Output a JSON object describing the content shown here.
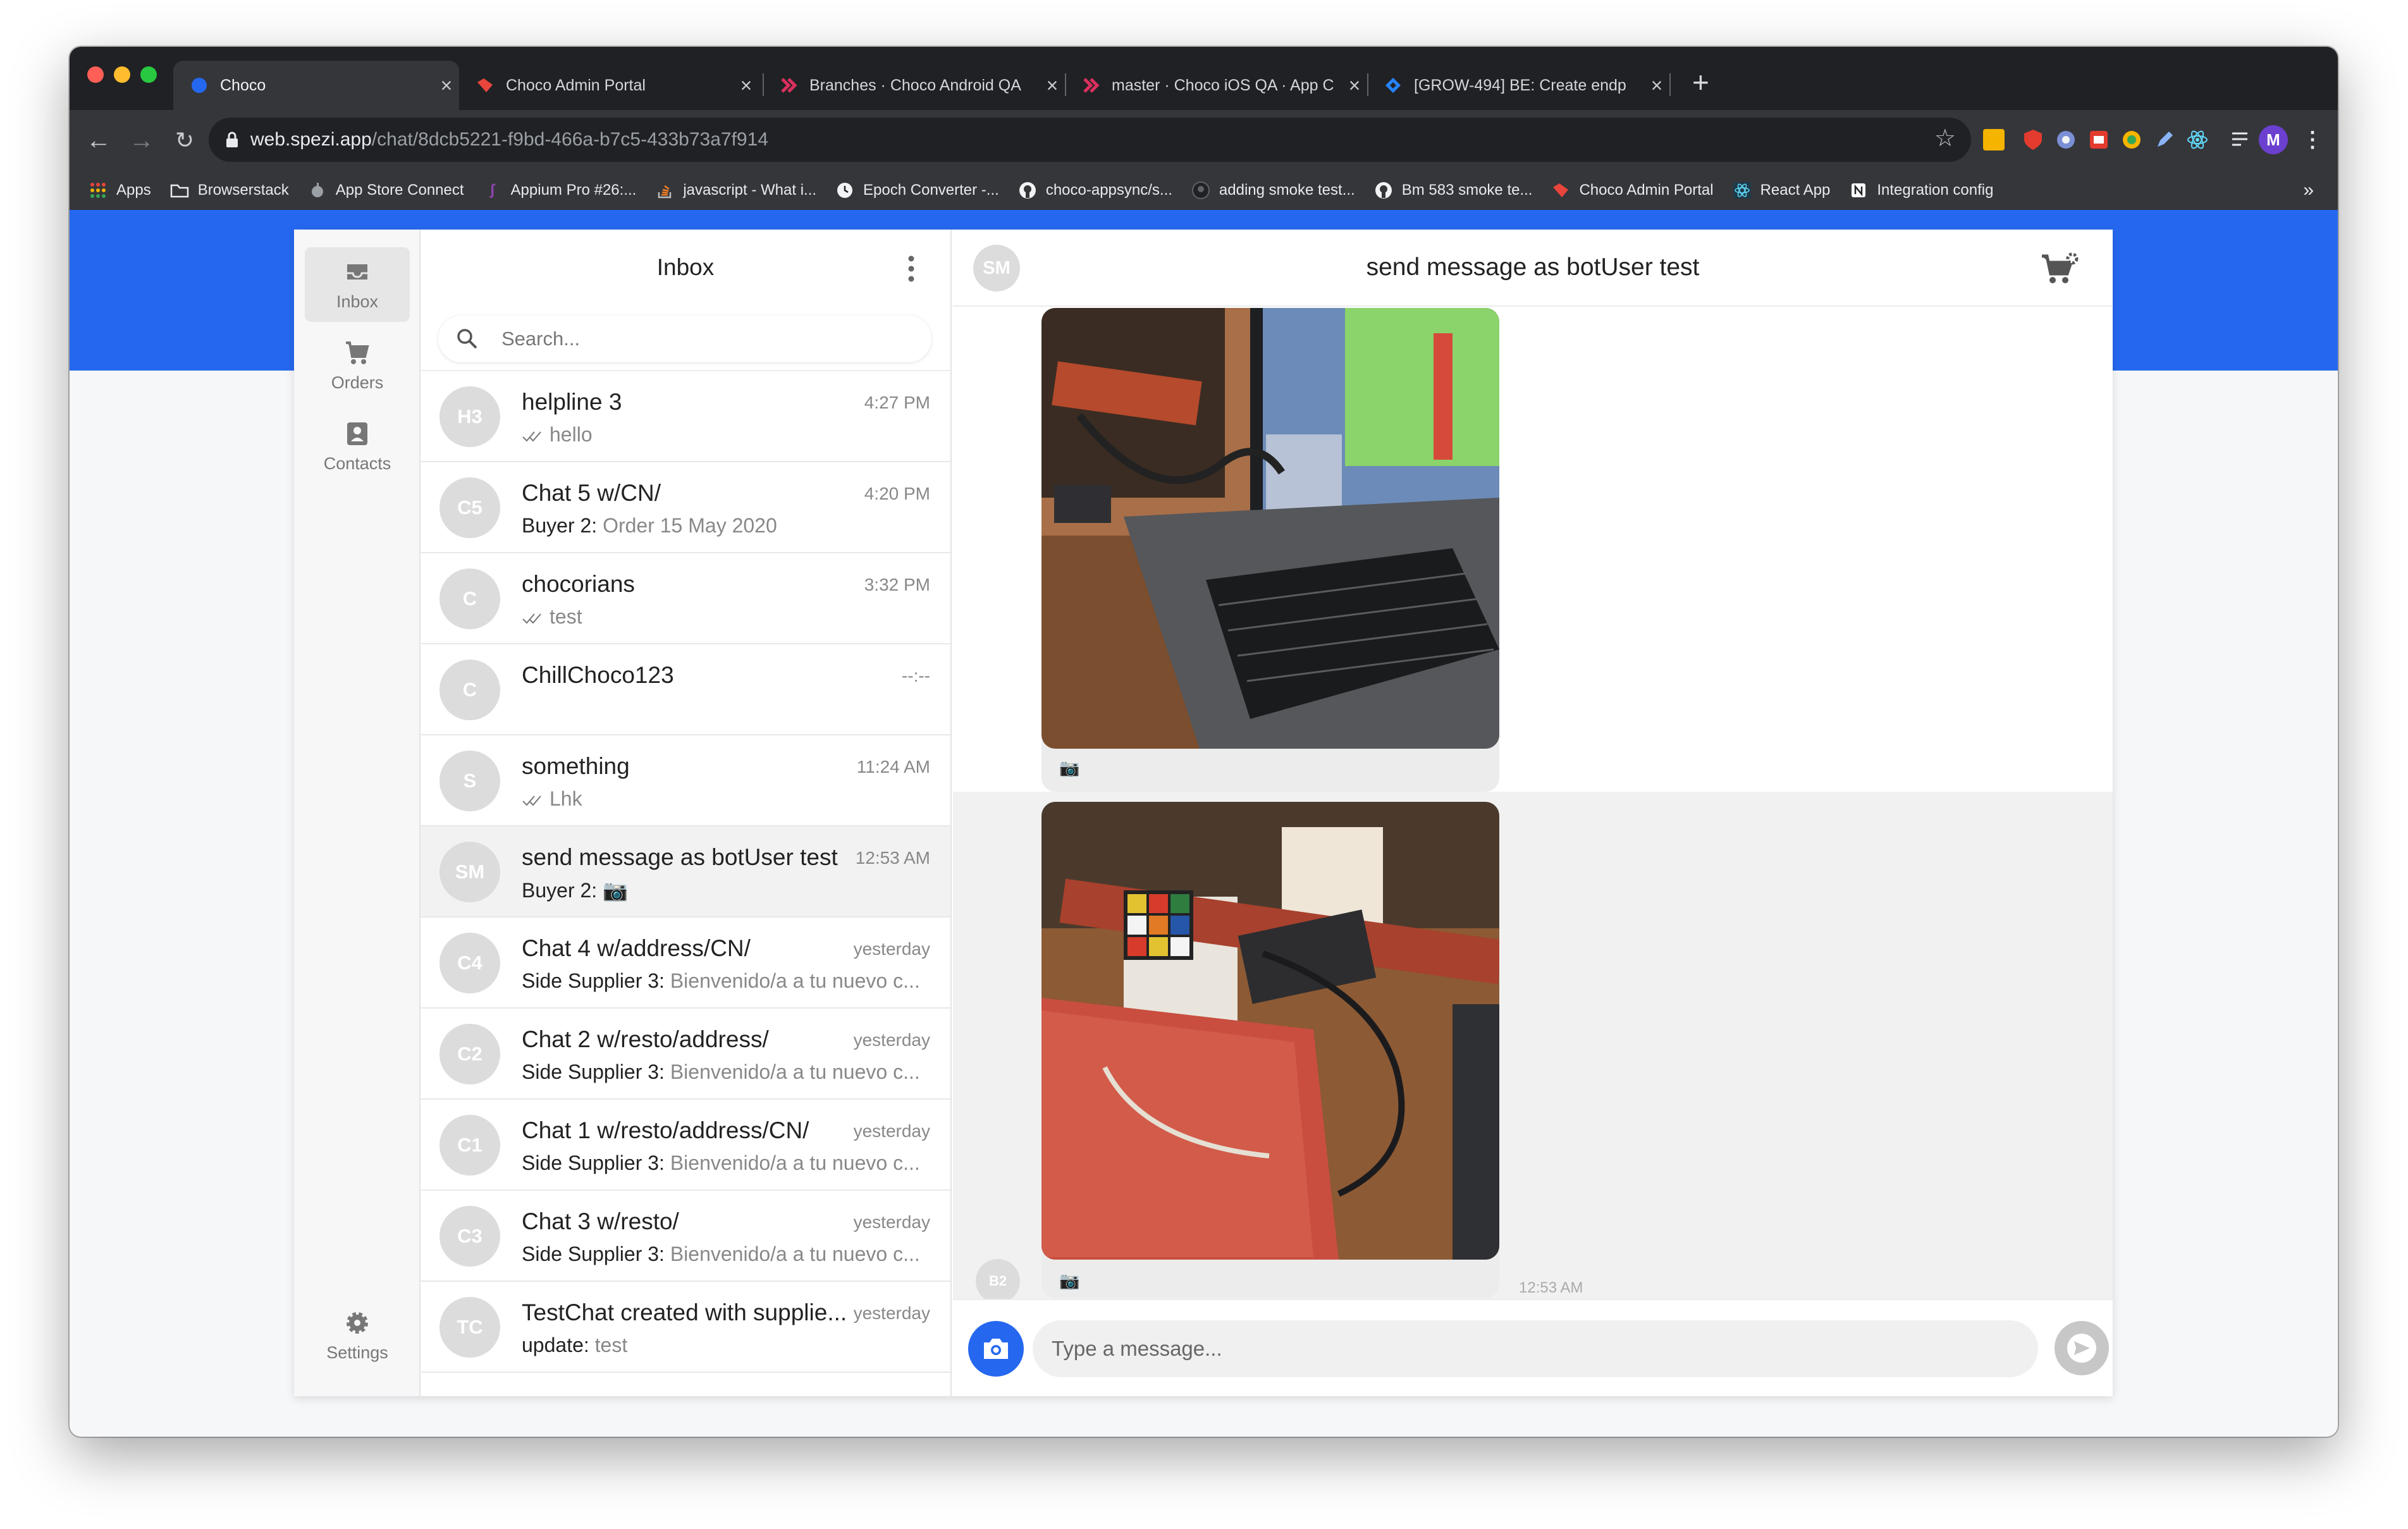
{
  "browser": {
    "tabs": [
      {
        "title": "Choco",
        "favicon": "blue-circle",
        "color": "#2568ef"
      },
      {
        "title": "Choco Admin Portal",
        "favicon": "choco-logo",
        "color": "#e8453c"
      },
      {
        "title": "Branches · Choco Android QA",
        "favicon": "bitrise-logo",
        "color": "#d9305d"
      },
      {
        "title": "master · Choco iOS QA · App C",
        "favicon": "bitrise-logo",
        "color": "#d9305d"
      },
      {
        "title": "[GROW-494] BE: Create endp",
        "favicon": "jira-logo",
        "color": "#2684ff"
      }
    ],
    "url_host": "web.spezi.app",
    "url_path": "/chat/8dcb5221-f9bd-466a-b7c5-433b73a7f914",
    "profile_initial": "M",
    "bookmarks": [
      {
        "label": "Apps",
        "icon": "apps-grid-icon"
      },
      {
        "label": "Browserstack",
        "icon": "folder-icon"
      },
      {
        "label": "App Store Connect",
        "icon": "apple-icon"
      },
      {
        "label": "Appium Pro #26:...",
        "icon": "appium-icon"
      },
      {
        "label": "javascript - What i...",
        "icon": "stackoverflow-icon"
      },
      {
        "label": "Epoch Converter -...",
        "icon": "clock-icon"
      },
      {
        "label": "choco-appsync/s...",
        "icon": "github-icon"
      },
      {
        "label": "adding smoke test...",
        "icon": "github-icon"
      },
      {
        "label": "Bm 583 smoke te...",
        "icon": "github-icon"
      },
      {
        "label": "Choco Admin Portal",
        "icon": "choco-logo"
      },
      {
        "label": "React App",
        "icon": "react-icon"
      },
      {
        "label": "Integration config",
        "icon": "notion-icon"
      }
    ],
    "bookmarks_overflow": "»"
  },
  "nav": {
    "inbox": "Inbox",
    "orders": "Orders",
    "contacts": "Contacts",
    "settings": "Settings"
  },
  "inbox": {
    "title": "Inbox",
    "search_placeholder": "Search...",
    "chats": [
      {
        "initials": "H3",
        "name": "helpline 3",
        "time": "4:27 PM",
        "sender": "",
        "preview": "hello",
        "read_ticks": true
      },
      {
        "initials": "C5",
        "name": "Chat 5 w/CN/",
        "time": "4:20 PM",
        "sender": "Buyer 2:",
        "preview": "Order 15 May 2020",
        "read_ticks": false
      },
      {
        "initials": "C",
        "name": "chocorians",
        "time": "3:32 PM",
        "sender": "",
        "preview": "test",
        "read_ticks": true
      },
      {
        "initials": "C",
        "name": "ChillChoco123",
        "time": "--:--",
        "sender": "",
        "preview": "",
        "read_ticks": false
      },
      {
        "initials": "S",
        "name": "something",
        "time": "11:24 AM",
        "sender": "",
        "preview": "Lhk",
        "read_ticks": true
      },
      {
        "initials": "SM",
        "name": "send message as botUser test",
        "time": "12:53 AM",
        "sender": "Buyer 2:",
        "preview": "📷",
        "read_ticks": false,
        "selected": true
      },
      {
        "initials": "C4",
        "name": "Chat 4 w/address/CN/",
        "time": "yesterday",
        "sender": "Side Supplier 3:",
        "preview": "Bienvenido/a a tu nuevo c...",
        "read_ticks": false
      },
      {
        "initials": "C2",
        "name": "Chat 2 w/resto/address/",
        "time": "yesterday",
        "sender": "Side Supplier 3:",
        "preview": "Bienvenido/a a tu nuevo c...",
        "read_ticks": false
      },
      {
        "initials": "C1",
        "name": "Chat 1 w/resto/address/CN/",
        "time": "yesterday",
        "sender": "Side Supplier 3:",
        "preview": "Bienvenido/a a tu nuevo c...",
        "read_ticks": false
      },
      {
        "initials": "C3",
        "name": "Chat 3 w/resto/",
        "time": "yesterday",
        "sender": "Side Supplier 3:",
        "preview": "Bienvenido/a a tu nuevo c...",
        "read_ticks": false
      },
      {
        "initials": "TC",
        "name": "TestChat created with supplie...",
        "time": "yesterday",
        "sender": "update:",
        "preview": "test",
        "read_ticks": false
      }
    ]
  },
  "chat": {
    "initials": "SM",
    "title": "send message as botUser test",
    "messages": [
      {
        "type": "photo",
        "caption": "📷",
        "sender_initials": "",
        "time": ""
      },
      {
        "type": "photo",
        "caption": "📷",
        "sender_initials": "B2",
        "time": "12:53 AM"
      }
    ],
    "input_placeholder": "Type a message..."
  },
  "colors": {
    "brand_blue": "#2568ef",
    "avatar_grey": "#dcdcdc",
    "chrome_dark": "#202124"
  }
}
